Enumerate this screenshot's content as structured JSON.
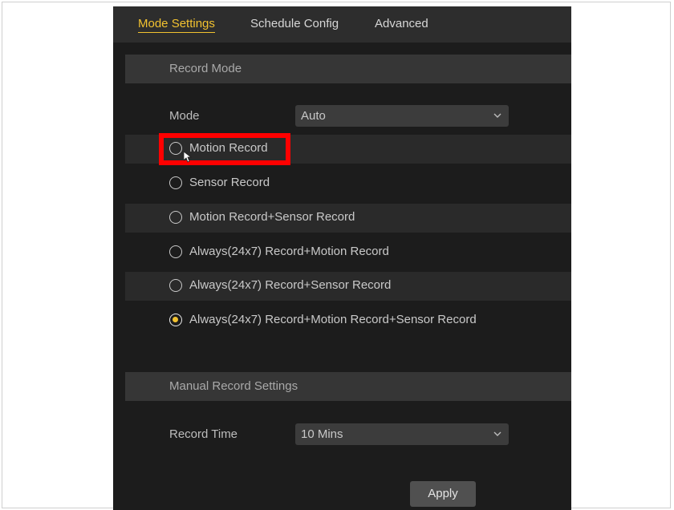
{
  "tabs": [
    {
      "label": "Mode Settings",
      "active": true
    },
    {
      "label": "Schedule Config",
      "active": false
    },
    {
      "label": "Advanced",
      "active": false
    }
  ],
  "record_mode": {
    "header": "Record Mode",
    "mode_label": "Mode",
    "mode_value": "Auto",
    "options": [
      {
        "label": "Motion Record",
        "selected": false,
        "highlighted": true
      },
      {
        "label": "Sensor Record",
        "selected": false
      },
      {
        "label": "Motion Record+Sensor Record",
        "selected": false
      },
      {
        "label": "Always(24x7) Record+Motion Record",
        "selected": false
      },
      {
        "label": "Always(24x7) Record+Sensor Record",
        "selected": false
      },
      {
        "label": "Always(24x7) Record+Motion Record+Sensor Record",
        "selected": true
      }
    ]
  },
  "manual_record": {
    "header": "Manual Record Settings",
    "record_time_label": "Record Time",
    "record_time_value": "10 Mins"
  },
  "apply_label": "Apply",
  "colors": {
    "accent": "#f2c230",
    "highlight": "#ff0000",
    "background": "#1c1c1c"
  }
}
